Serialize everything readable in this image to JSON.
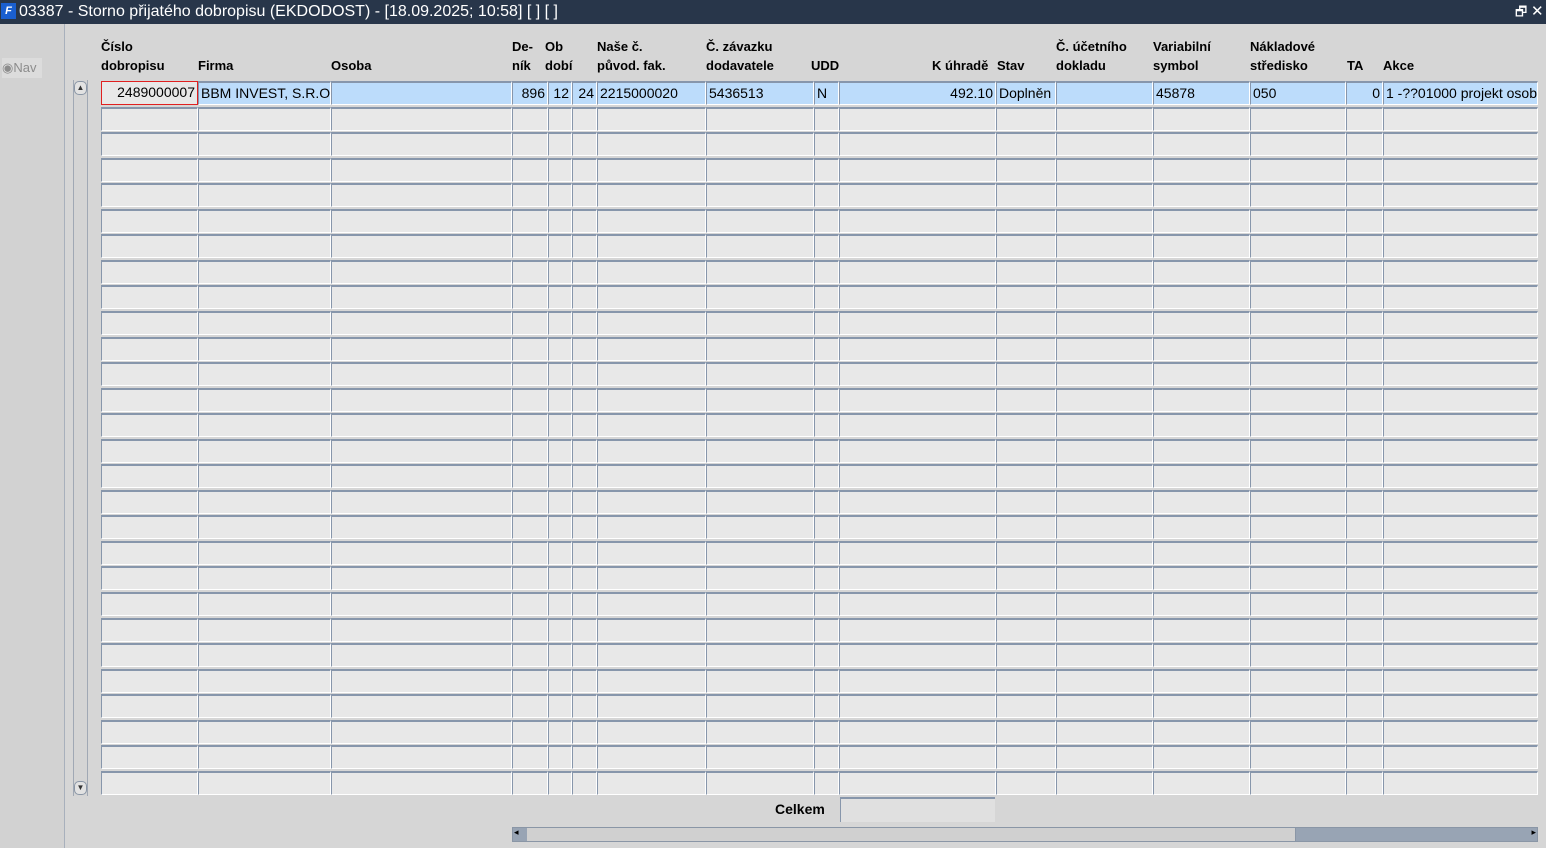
{
  "window": {
    "title": "03387 - Storno přijatého dobropisu (EKDODOST) - [18.09.2025; 10:58]  [ ]  [ ]",
    "restore_icon": "restore-icon",
    "close_icon": "close-icon"
  },
  "nav": {
    "label": "Nav"
  },
  "headers": [
    [
      "Číslo",
      "dobropisu"
    ],
    [
      "",
      "Firma"
    ],
    [
      "",
      "Osoba"
    ],
    [
      "De-",
      "ník"
    ],
    [
      "Ob",
      "dobí"
    ],
    [
      "",
      ""
    ],
    [
      "Naše č.",
      "původ. fak."
    ],
    [
      "Č. závazku",
      "dodavatele"
    ],
    [
      "",
      "UDD"
    ],
    [
      "",
      "K úhradě"
    ],
    [
      "",
      "Stav"
    ],
    [
      "Č. účetního",
      "dokladu"
    ],
    [
      "Variabilní",
      "symbol"
    ],
    [
      "Nákladové",
      "středisko"
    ],
    [
      "",
      "TA"
    ],
    [
      "",
      "Akce"
    ]
  ],
  "rows": [
    [
      "2489000007",
      "BBM INVEST, S.R.O",
      "",
      "896",
      "12",
      "24",
      "2215000020",
      "5436513",
      "N",
      "492.10",
      "Doplněn",
      "",
      "45878",
      "050",
      "0",
      "1 -??01000 projekt osob"
    ]
  ],
  "row_count": 28,
  "footer": {
    "total_label": "Celkem",
    "total_value": ""
  }
}
